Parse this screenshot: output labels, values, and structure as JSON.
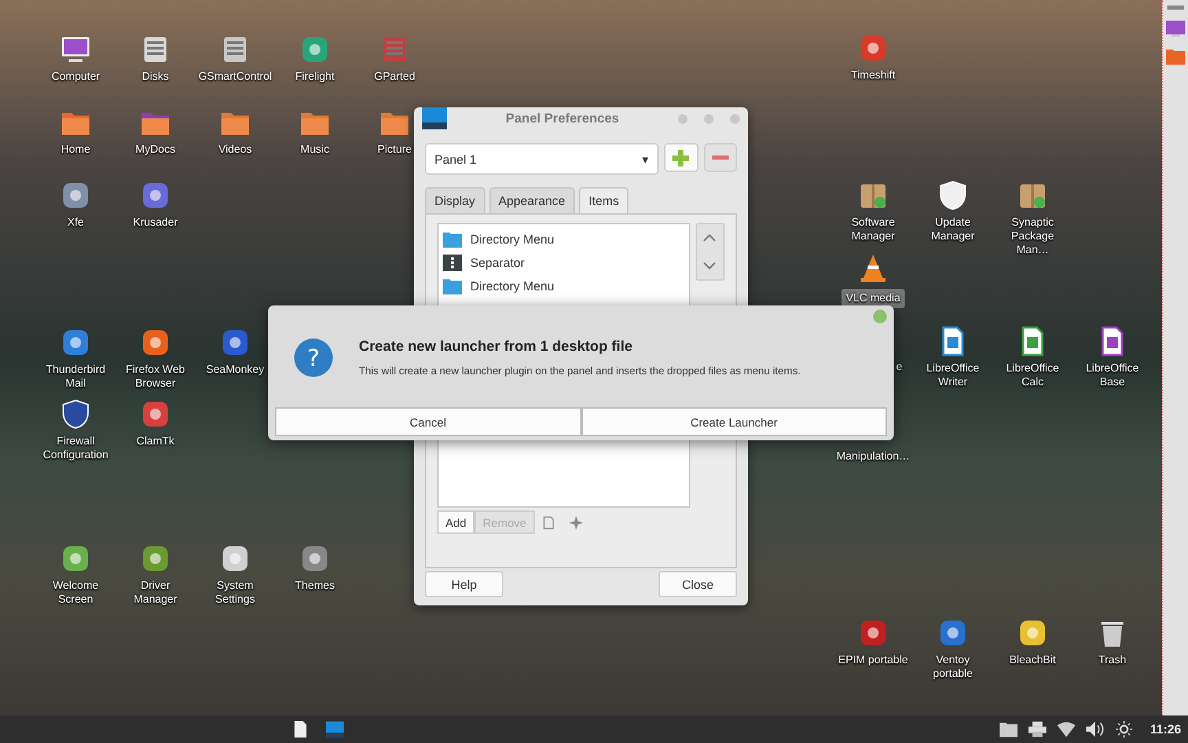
{
  "desktop": {
    "items": [
      {
        "label": "Computer",
        "kind": "monitor",
        "hovered": false
      },
      {
        "label": "Disks",
        "kind": "drive",
        "hovered": false
      },
      {
        "label": "GSmartControl",
        "kind": "drive",
        "hovered": false
      },
      {
        "label": "Firelight",
        "kind": "app",
        "hovered": false
      },
      {
        "label": "GParted",
        "kind": "drive",
        "hovered": false
      },
      {
        "label": "Home",
        "kind": "folder",
        "hovered": false
      },
      {
        "label": "MyDocs",
        "kind": "folder",
        "hovered": false
      },
      {
        "label": "Videos",
        "kind": "folder",
        "hovered": false
      },
      {
        "label": "Music",
        "kind": "folder",
        "hovered": false
      },
      {
        "label": "Picture",
        "kind": "folder",
        "hovered": false
      },
      {
        "label": "Xfe",
        "kind": "app",
        "hovered": false
      },
      {
        "label": "Krusader",
        "kind": "app",
        "hovered": false
      },
      {
        "label": "Thunderbird Mail",
        "kind": "app",
        "hovered": false
      },
      {
        "label": "Firefox Web Browser",
        "kind": "app",
        "hovered": false
      },
      {
        "label": "SeaMonkey",
        "kind": "app",
        "hovered": false
      },
      {
        "label": "Firewall Configuration",
        "kind": "shield",
        "hovered": false
      },
      {
        "label": "ClamTk",
        "kind": "app",
        "hovered": false
      },
      {
        "label": "Welcome Screen",
        "kind": "app",
        "hovered": false
      },
      {
        "label": "Driver Manager",
        "kind": "app",
        "hovered": false
      },
      {
        "label": "System Settings",
        "kind": "app",
        "hovered": false
      },
      {
        "label": "Themes",
        "kind": "app",
        "hovered": false
      },
      {
        "label": "Timeshift",
        "kind": "app",
        "hovered": false
      },
      {
        "label": "Software Manager",
        "kind": "package",
        "hovered": false
      },
      {
        "label": "Update Manager",
        "kind": "shield",
        "hovered": false
      },
      {
        "label": "Synaptic Package Man…",
        "kind": "package",
        "hovered": false
      },
      {
        "label": "VLC media",
        "kind": "cone",
        "hovered": true
      },
      {
        "label": "e",
        "kind": "fragment",
        "hovered": false
      },
      {
        "label": "LibreOffice Writer",
        "kind": "document",
        "hovered": false
      },
      {
        "label": "LibreOffice Calc",
        "kind": "document",
        "hovered": false
      },
      {
        "label": "LibreOffice Base",
        "kind": "document",
        "hovered": false
      },
      {
        "label": "Manipulation…",
        "kind": "fragment",
        "hovered": false
      },
      {
        "label": "EPIM portable",
        "kind": "app",
        "hovered": false
      },
      {
        "label": "Ventoy portable",
        "kind": "app",
        "hovered": false
      },
      {
        "label": "BleachBit",
        "kind": "app",
        "hovered": false
      },
      {
        "label": "Trash",
        "kind": "trash",
        "hovered": false
      }
    ]
  },
  "panel_preferences": {
    "title": "Panel Preferences",
    "panel_select": "Panel 1",
    "dropdown_arrow": "▾",
    "tabs": [
      {
        "label": "Display",
        "selected": false
      },
      {
        "label": "Appearance",
        "selected": false
      },
      {
        "label": "Items",
        "selected": true
      }
    ],
    "items": [
      {
        "label": "Directory Menu",
        "kind": "folder"
      },
      {
        "label": "Separator",
        "kind": "separator"
      },
      {
        "label": "Directory Menu",
        "kind": "folder"
      }
    ],
    "toolbar": [
      {
        "label": "Add",
        "disabled": false
      },
      {
        "label": "Remove",
        "disabled": true
      }
    ],
    "buttons": [
      "Help",
      "Close"
    ]
  },
  "dialog": {
    "icon_glyph": "?",
    "title": "Create new launcher from 1 desktop file",
    "message": "This will create a new launcher plugin on the panel and inserts the dropped files as menu items.",
    "buttons": [
      "Cancel",
      "Create Launcher"
    ]
  },
  "taskbar": {
    "clock": "11:26"
  }
}
